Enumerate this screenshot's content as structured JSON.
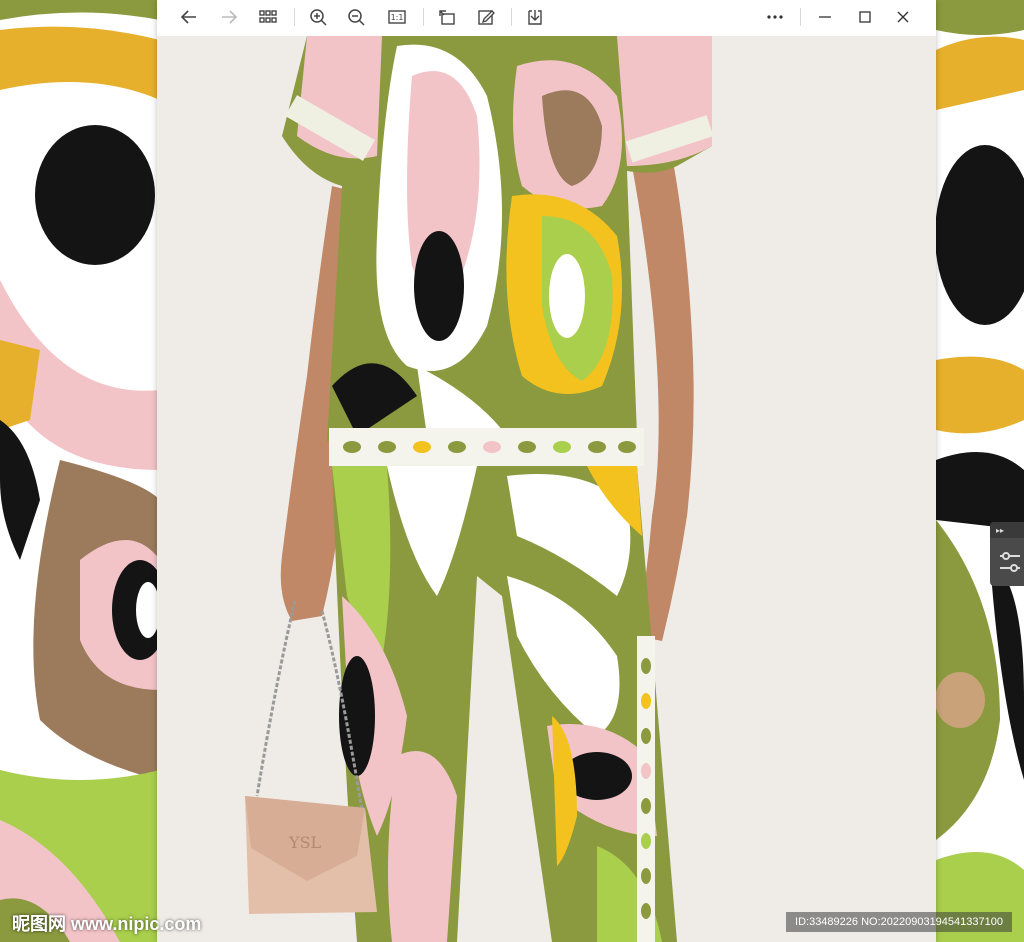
{
  "toolbar": {
    "buttons": [
      {
        "name": "back-button",
        "icon": "arrow-left-icon"
      },
      {
        "name": "forward-button",
        "icon": "arrow-right-icon"
      },
      {
        "name": "grid-view-button",
        "icon": "grid-icon"
      },
      {
        "name": "zoom-in-button",
        "icon": "zoom-in-icon"
      },
      {
        "name": "zoom-out-button",
        "icon": "zoom-out-icon"
      },
      {
        "name": "actual-size-button",
        "icon": "one-to-one-icon"
      },
      {
        "name": "rotate-button",
        "icon": "rotate-icon"
      },
      {
        "name": "edit-button",
        "icon": "edit-icon"
      },
      {
        "name": "save-button",
        "icon": "download-icon"
      },
      {
        "name": "more-button",
        "icon": "more-icon"
      },
      {
        "name": "minimize-button",
        "icon": "minimize-icon"
      },
      {
        "name": "maximize-button",
        "icon": "maximize-icon"
      },
      {
        "name": "close-button",
        "icon": "close-icon"
      }
    ],
    "actual_size_label": "1:1"
  },
  "watermark": {
    "site": "昵图网 www.nipic.com",
    "id_text": "ID:33489226 NO:20220903194541337100"
  },
  "colors": {
    "olive": "#8b9a3e",
    "pink": "#f2c4c8",
    "yellow": "#f3c21f",
    "lime": "#a9cf4c",
    "brown": "#9c7a5c",
    "black": "#141414",
    "white": "#ffffff",
    "wall": "#efece7"
  }
}
